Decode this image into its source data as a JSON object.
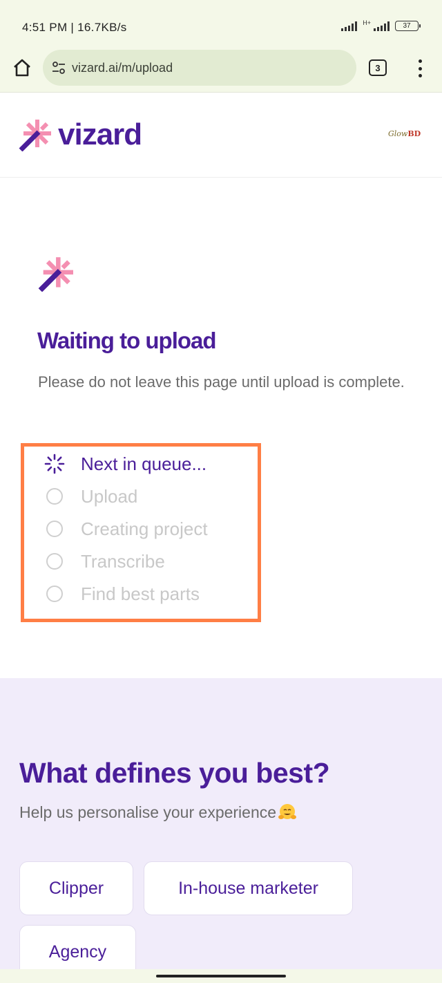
{
  "status_bar": {
    "time": "4:51 PM | 16.7KB/s",
    "network_label": "H+",
    "battery": "37"
  },
  "browser": {
    "url": "vizard.ai/m/upload",
    "tab_count": "3",
    "icons": [
      "home-icon",
      "site-settings-icon",
      "tabs-icon",
      "more-vert-icon"
    ]
  },
  "header": {
    "brand": "vizard",
    "partner_logo_main": "Glow",
    "partner_logo_accent": "BD"
  },
  "upload": {
    "title": "Waiting to upload",
    "subtitle": "Please do not leave this page until upload is complete.",
    "steps": [
      {
        "label": "Next in queue...",
        "state": "active"
      },
      {
        "label": "Upload",
        "state": "pending"
      },
      {
        "label": "Creating project",
        "state": "pending"
      },
      {
        "label": "Transcribe",
        "state": "pending"
      },
      {
        "label": "Find best parts",
        "state": "pending"
      }
    ]
  },
  "survey": {
    "title": "What defines you best?",
    "subtitle": "Help us personalise your experience",
    "subtitle_emoji": "hugging-face-emoji",
    "options": [
      "Clipper",
      "In-house marketer",
      "Agency"
    ]
  },
  "colors": {
    "brand_purple": "#4a1e99",
    "brand_pink": "#f48fb1",
    "highlight_orange": "#ff7e45",
    "survey_bg": "#f1ecfa",
    "browser_bg": "#f4f8e8"
  }
}
